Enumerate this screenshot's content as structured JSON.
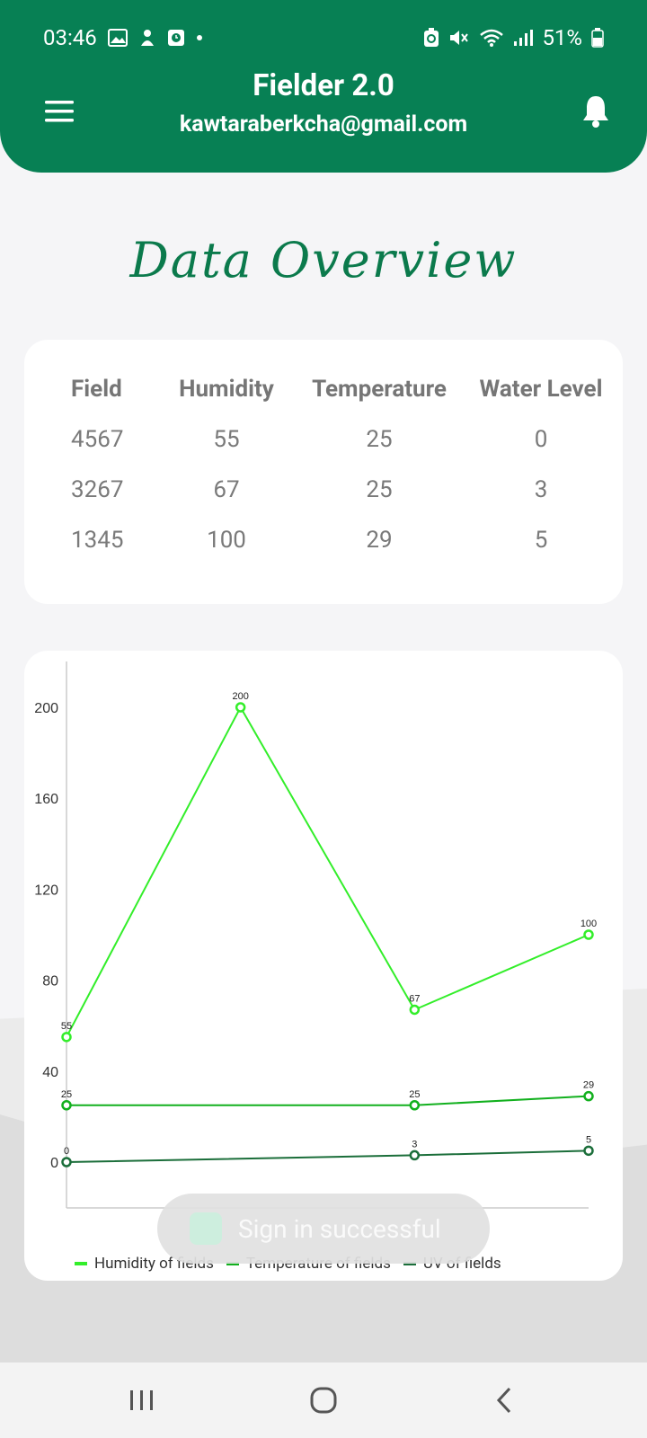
{
  "status": {
    "time": "03:46",
    "battery": "51%"
  },
  "header": {
    "title": "Fielder 2.0",
    "email": "kawtaraberkcha@gmail.com"
  },
  "heading": "Data Overview",
  "table": {
    "headers": [
      "Field",
      "Humidity",
      "Temperature",
      "Water Level"
    ],
    "rows": [
      [
        "4567",
        "55",
        "25",
        "0"
      ],
      [
        "3267",
        "67",
        "25",
        "3"
      ],
      [
        "1345",
        "100",
        "29",
        "5"
      ]
    ]
  },
  "chart_data": {
    "type": "line",
    "x": [
      0,
      1,
      2,
      3
    ],
    "ylim": [
      0,
      200
    ],
    "yticks": [
      0,
      40,
      80,
      120,
      160,
      200
    ],
    "series": [
      {
        "name": "Humidity of fields",
        "color": "#33ee2a",
        "values": [
          55,
          200,
          67,
          100
        ]
      },
      {
        "name": "Temperature of fields",
        "color": "#12b01e",
        "values": [
          25,
          null,
          25,
          29
        ]
      },
      {
        "name": "UV of fields",
        "color": "#1b6e3a",
        "values": [
          0,
          null,
          3,
          5
        ]
      }
    ]
  },
  "toast": {
    "text": "Sign in successful"
  },
  "colors": {
    "primary": "#078054",
    "heading": "#0b7a4c"
  }
}
